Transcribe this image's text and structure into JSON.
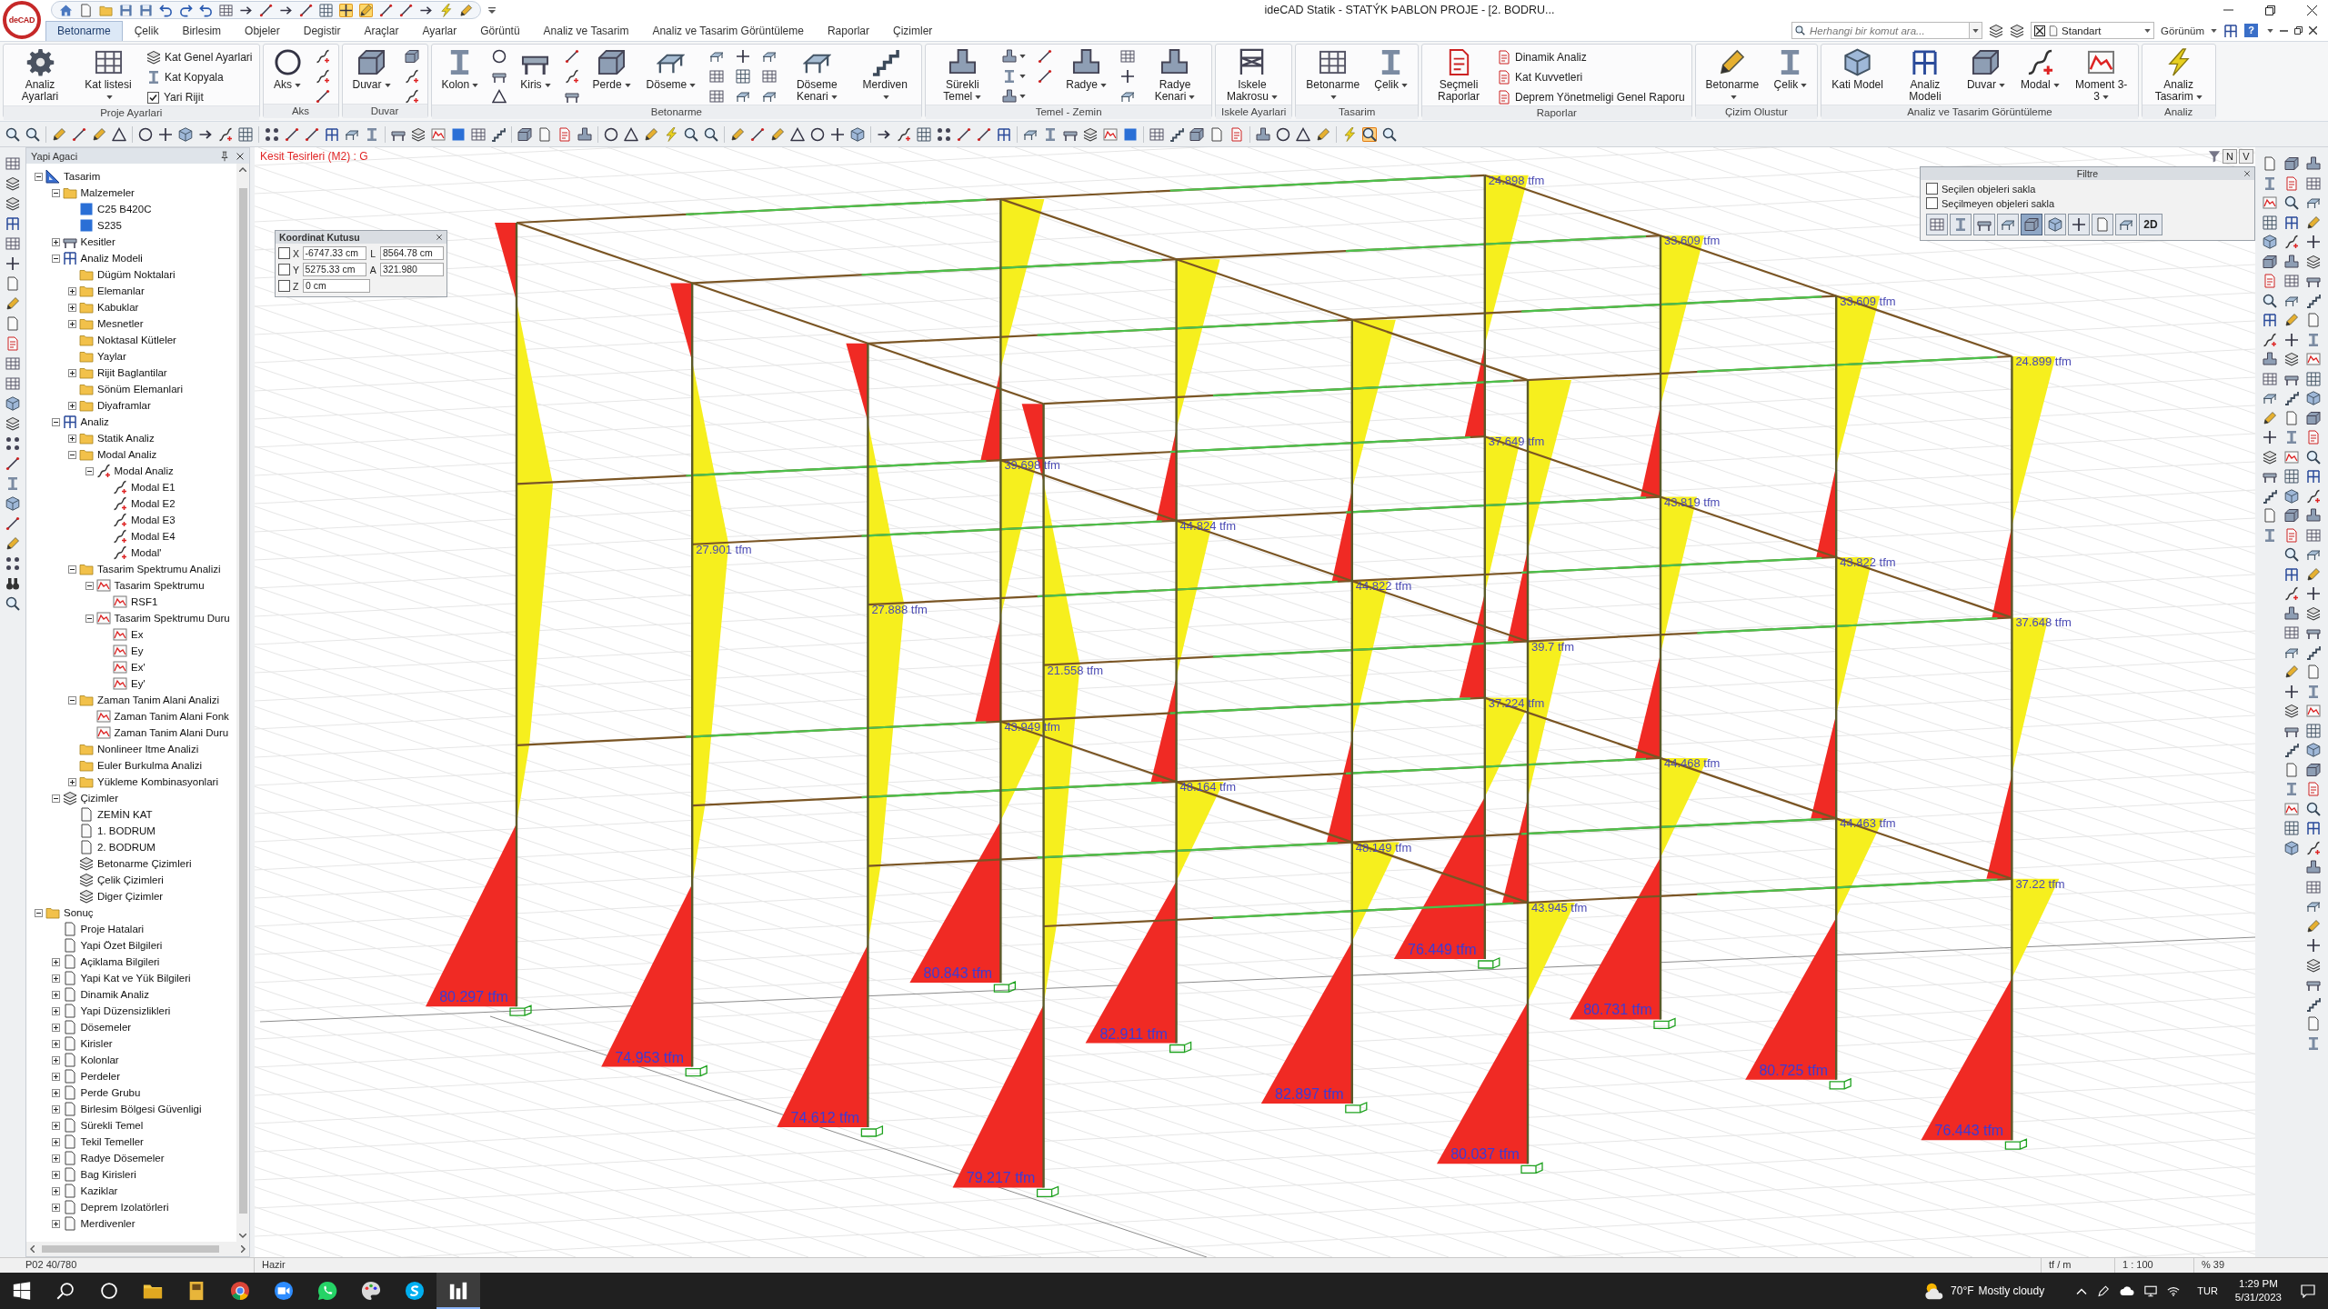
{
  "title_bar": {
    "logo": "deCAD",
    "quick_access": [
      {
        "on": false
      },
      {
        "on": false
      },
      {
        "on": false
      },
      {
        "on": false
      },
      {
        "on": false
      },
      {
        "on": false
      },
      {
        "on": false
      },
      {
        "on": false
      },
      {
        "on": false
      },
      {
        "on": false
      },
      {
        "on": false
      },
      {
        "on": false
      },
      {
        "on": false
      },
      {
        "on": false
      },
      {
        "on": true
      },
      {
        "on": true
      },
      {
        "on": false
      },
      {
        "on": false
      },
      {
        "on": false
      },
      {
        "on": false
      },
      {
        "on": false
      }
    ],
    "title": "ideCAD Statik - STATÝK ÞABLON PROJE - [2. BODRU..."
  },
  "ribbon": {
    "tabs": [
      {
        "label": "Betonarme",
        "selected": true
      },
      {
        "label": "Çelik",
        "selected": false
      },
      {
        "label": "Birlesim",
        "selected": false
      },
      {
        "label": "Objeler",
        "selected": false
      },
      {
        "label": "Degistir",
        "selected": false
      },
      {
        "label": "Araçlar",
        "selected": false
      },
      {
        "label": "Ayarlar",
        "selected": false
      },
      {
        "label": "Görüntü",
        "selected": false
      },
      {
        "label": "Analiz ve Tasarim",
        "selected": false
      },
      {
        "label": "Analiz ve Tasarim Görüntüleme",
        "selected": false
      },
      {
        "label": "Raporlar",
        "selected": false
      },
      {
        "label": "Çizimler",
        "selected": false
      }
    ],
    "search": {
      "placeholder": "Herhangi bir komut ara..."
    },
    "style_select": {
      "value": "Standart"
    },
    "view_menu": {
      "label": "Görünüm"
    },
    "help": "?",
    "groups": [
      {
        "label": "Proje Ayarlari",
        "items": [
          {
            "kind": "large",
            "label": "Analiz Ayarlari",
            "dropdown": false
          },
          {
            "kind": "large",
            "label": "Kat listesi",
            "dropdown": true
          },
          {
            "kind": "stack",
            "items": [
              {
                "kind": "small",
                "label": "Kat Genel Ayarlari"
              },
              {
                "kind": "small",
                "label": "Kat Kopyala"
              },
              {
                "kind": "check",
                "label": "Yari Rijit",
                "checked": true
              }
            ]
          }
        ]
      },
      {
        "label": "Aks",
        "items": [
          {
            "kind": "large",
            "label": "Aks",
            "dropdown": true
          },
          {
            "kind": "icon_column"
          }
        ]
      },
      {
        "label": "Duvar",
        "items": [
          {
            "kind": "large",
            "label": "Duvar",
            "dropdown": true
          },
          {
            "kind": "icon_column"
          }
        ]
      },
      {
        "label": "Betonarme",
        "items": [
          {
            "kind": "large",
            "label": "Kolon",
            "dropdown": true
          },
          {
            "kind": "icon_column"
          },
          {
            "kind": "large",
            "label": "Kiris",
            "dropdown": true
          },
          {
            "kind": "icon_column"
          },
          {
            "kind": "large",
            "label": "Perde",
            "dropdown": true
          },
          {
            "kind": "large",
            "label": "Döseme",
            "dropdown": true
          },
          {
            "kind": "icon_column"
          },
          {
            "kind": "icon_column"
          },
          {
            "kind": "icon_column"
          },
          {
            "kind": "large",
            "label": "Döseme Kenari",
            "dropdown": true
          },
          {
            "kind": "large",
            "label": "Merdiven",
            "dropdown": true
          }
        ]
      },
      {
        "label": "Temel - Zemin",
        "items": [
          {
            "kind": "large",
            "label": "Sürekli Temel",
            "dropdown": true
          },
          {
            "kind": "icon_column"
          },
          {
            "kind": "icon_column"
          },
          {
            "kind": "large",
            "label": "Radye",
            "dropdown": true
          },
          {
            "kind": "icon_column"
          },
          {
            "kind": "large",
            "label": "Radye Kenari",
            "dropdown": true
          }
        ]
      },
      {
        "label": "Iskele Ayarlari",
        "items": [
          {
            "kind": "large",
            "label": "Iskele Makrosu",
            "dropdown": true
          }
        ]
      },
      {
        "label": "Tasarim",
        "items": [
          {
            "kind": "large",
            "label": "Betonarme",
            "dropdown": true
          },
          {
            "kind": "large",
            "label": "Çelik",
            "dropdown": true
          }
        ]
      },
      {
        "label": "Raporlar",
        "items": [
          {
            "kind": "large",
            "label": "Seçmeli Raporlar",
            "dropdown": false
          },
          {
            "kind": "stack",
            "items": [
              {
                "kind": "small",
                "label": "Dinamik Analiz"
              },
              {
                "kind": "small",
                "label": "Kat Kuvvetleri"
              },
              {
                "kind": "small",
                "label": "Deprem Yönetmeligi Genel Raporu"
              }
            ]
          }
        ]
      },
      {
        "label": "Çizim Olustur",
        "items": [
          {
            "kind": "large",
            "label": "Betonarme",
            "dropdown": true
          },
          {
            "kind": "large",
            "label": "Çelik",
            "dropdown": true
          }
        ]
      },
      {
        "label": "Analiz ve Tasarim Görüntüleme",
        "items": [
          {
            "kind": "large",
            "label": "Kati Model",
            "dropdown": false
          },
          {
            "kind": "large",
            "label": "Analiz Modeli",
            "dropdown": false
          },
          {
            "kind": "large",
            "label": "Duvar",
            "dropdown": true
          },
          {
            "kind": "large",
            "label": "Modal",
            "dropdown": true
          },
          {
            "kind": "large",
            "label": "Moment 3-3",
            "dropdown": true
          }
        ]
      },
      {
        "label": "Analiz",
        "items": [
          {
            "kind": "large",
            "label": "Analiz Tasarim",
            "dropdown": true
          }
        ]
      }
    ]
  },
  "toolbar": [
    {
      "on": false
    },
    {
      "on": false
    },
    {
      "on": false
    },
    {
      "on": false
    },
    {
      "on": false
    },
    {
      "on": false
    },
    {
      "on": false
    },
    {
      "on": false
    },
    {
      "on": false
    },
    {
      "on": false
    },
    {
      "on": false
    },
    {
      "on": false
    },
    {
      "on": false
    },
    {
      "on": false
    },
    {
      "on": false
    },
    {
      "on": false
    },
    {
      "on": false
    },
    {
      "on": false
    },
    {
      "on": false
    },
    {
      "on": false
    },
    {
      "on": false
    },
    {
      "on": false
    },
    {
      "on": false
    },
    {
      "on": false
    },
    {
      "on": false
    },
    {
      "on": false
    },
    {
      "on": false
    },
    {
      "on": false
    },
    {
      "on": false
    },
    {
      "on": false
    },
    {
      "on": false
    },
    {
      "on": false
    },
    {
      "on": false
    },
    {
      "on": false
    },
    {
      "on": false
    },
    {
      "on": false
    },
    {
      "on": false
    },
    {
      "on": false
    },
    {
      "on": false
    },
    {
      "on": false
    },
    {
      "on": false
    },
    {
      "on": false
    },
    {
      "on": false
    },
    {
      "on": false
    },
    {
      "on": false
    },
    {
      "on": false
    },
    {
      "on": false
    },
    {
      "on": false
    },
    {
      "on": false
    },
    {
      "on": false
    },
    {
      "on": false
    },
    {
      "on": false
    },
    {
      "on": false
    },
    {
      "on": false
    },
    {
      "on": false
    },
    {
      "on": false
    },
    {
      "on": false
    },
    {
      "on": false
    },
    {
      "on": false
    },
    {
      "on": false
    },
    {
      "on": false
    },
    {
      "on": false
    },
    {
      "on": false
    },
    {
      "on": false
    },
    {
      "on": true
    },
    {
      "on": false
    }
  ],
  "tree_panel": {
    "title": "Yapi Agaci",
    "items": [
      {
        "label": "Tasarim",
        "kind": "set_square",
        "expanded": true,
        "children": [
          {
            "label": "Malzemeler",
            "kind": "folder",
            "expanded": true,
            "children": [
              {
                "label": "C25 B420C",
                "kind": "material"
              },
              {
                "label": "S235",
                "kind": "material"
              }
            ]
          },
          {
            "label": "Kesitler",
            "kind": "section",
            "expanded": false
          },
          {
            "label": "Analiz Modeli",
            "kind": "frame",
            "expanded": true,
            "children": [
              {
                "label": "Dügüm Noktalari",
                "kind": "folder"
              },
              {
                "label": "Elemanlar",
                "kind": "folder",
                "expanded": false
              },
              {
                "label": "Kabuklar",
                "kind": "folder",
                "expanded": false
              },
              {
                "label": "Mesnetler",
                "kind": "folder",
                "expanded": false
              },
              {
                "label": "Noktasal Kütleler",
                "kind": "folder"
              },
              {
                "label": "Yaylar",
                "kind": "folder"
              },
              {
                "label": "Rijit Baglantilar",
                "kind": "folder",
                "expanded": false
              },
              {
                "label": "Sönüm Elemanlari",
                "kind": "folder"
              },
              {
                "label": "Diyaframlar",
                "kind": "folder",
                "expanded": false
              }
            ]
          },
          {
            "label": "Analiz",
            "kind": "frame",
            "expanded": true,
            "children": [
              {
                "label": "Statik Analiz",
                "kind": "folder",
                "expanded": false
              },
              {
                "label": "Modal Analiz",
                "kind": "folder",
                "expanded": true,
                "children": [
                  {
                    "label": "Modal Analiz",
                    "kind": "curve",
                    "expanded": true,
                    "children": [
                      {
                        "label": "Modal E1",
                        "kind": "curve"
                      },
                      {
                        "label": "Modal E2",
                        "kind": "curve"
                      },
                      {
                        "label": "Modal E3",
                        "kind": "curve"
                      },
                      {
                        "label": "Modal E4",
                        "kind": "curve"
                      },
                      {
                        "label": "Modal'",
                        "kind": "curve"
                      }
                    ]
                  }
                ]
              },
              {
                "label": "Tasarim Spektrumu Analizi",
                "kind": "folder",
                "expanded": true,
                "children": [
                  {
                    "label": "Tasarim Spektrumu",
                    "kind": "graph",
                    "expanded": true,
                    "children": [
                      {
                        "label": "RSF1",
                        "kind": "graph"
                      }
                    ]
                  },
                  {
                    "label": "Tasarim Spektrumu Duru",
                    "kind": "graph",
                    "expanded": true,
                    "children": [
                      {
                        "label": "Ex",
                        "kind": "graph"
                      },
                      {
                        "label": "Ey",
                        "kind": "graph"
                      },
                      {
                        "label": "Ex'",
                        "kind": "graph"
                      },
                      {
                        "label": "Ey'",
                        "kind": "graph"
                      }
                    ]
                  }
                ]
              },
              {
                "label": "Zaman Tanim Alani Analizi",
                "kind": "folder",
                "expanded": true,
                "children": [
                  {
                    "label": "Zaman Tanim Alani Fonk",
                    "kind": "graph"
                  },
                  {
                    "label": "Zaman Tanim Alani Duru",
                    "kind": "graph"
                  }
                ]
              },
              {
                "label": "Nonlineer Itme Analizi",
                "kind": "folder"
              },
              {
                "label": "Euler Burkulma Analizi",
                "kind": "folder"
              },
              {
                "label": "Yükleme Kombinasyonlari",
                "kind": "folder",
                "expanded": false
              }
            ]
          },
          {
            "label": "Çizimler",
            "kind": "layers",
            "expanded": true,
            "children": [
              {
                "label": "ZEMİN KAT",
                "kind": "page"
              },
              {
                "label": "1. BODRUM",
                "kind": "page"
              },
              {
                "label": "2. BODRUM",
                "kind": "page"
              },
              {
                "label": "Betonarme Çizimleri",
                "kind": "layers"
              },
              {
                "label": "Çelik Çizimleri",
                "kind": "layers"
              },
              {
                "label": "Diger Çizimler",
                "kind": "layers"
              }
            ]
          }
        ]
      },
      {
        "label": "Sonuç",
        "kind": "folder",
        "expanded": true,
        "children": [
          {
            "label": "Proje Hatalari",
            "kind": "page"
          },
          {
            "label": "Yapi Özet Bilgileri",
            "kind": "page"
          },
          {
            "label": "Açiklama Bilgileri",
            "kind": "page",
            "expanded": false
          },
          {
            "label": "Yapi Kat ve Yük Bilgileri",
            "kind": "page",
            "expanded": false
          },
          {
            "label": "Dinamik Analiz",
            "kind": "page",
            "expanded": false
          },
          {
            "label": "Yapi Düzensizlikleri",
            "kind": "page",
            "expanded": false
          },
          {
            "label": "Dösemeler",
            "kind": "page",
            "expanded": false
          },
          {
            "label": "Kirisler",
            "kind": "page",
            "expanded": false
          },
          {
            "label": "Kolonlar",
            "kind": "page",
            "expanded": false
          },
          {
            "label": "Perdeler",
            "kind": "page",
            "expanded": false
          },
          {
            "label": "Perde Grubu",
            "kind": "page",
            "expanded": false
          },
          {
            "label": "Birlesim Bölgesi Güvenligi",
            "kind": "page",
            "expanded": false
          },
          {
            "label": "Sürekli Temel",
            "kind": "page",
            "expanded": false
          },
          {
            "label": "Tekil Temeller",
            "kind": "page",
            "expanded": false
          },
          {
            "label": "Radye Dösemeler",
            "kind": "page",
            "expanded": false
          },
          {
            "label": "Bag Kirisleri",
            "kind": "page",
            "expanded": false
          },
          {
            "label": "Kaziklar",
            "kind": "page",
            "expanded": false
          },
          {
            "label": "Deprem Izolatörleri",
            "kind": "page",
            "expanded": false
          },
          {
            "label": "Merdivenler",
            "kind": "page",
            "expanded": false
          }
        ]
      }
    ]
  },
  "canvas": {
    "view_title": "Kesit Tesirleri (M2) : G",
    "view_buttons": [
      "N",
      "V"
    ],
    "coordinate_box": {
      "title": "Koordinat Kutusu",
      "rows": [
        {
          "axis": "X",
          "checked": false,
          "value": "-6747.33 cm",
          "extra_label": "L",
          "extra_value": "8564.78 cm"
        },
        {
          "axis": "Y",
          "checked": false,
          "value": "5275.33 cm",
          "extra_label": "A",
          "extra_value": "321.980"
        },
        {
          "axis": "Z",
          "checked": false,
          "value": "0 cm"
        }
      ]
    },
    "filter_panel": {
      "title": "Filtre",
      "options": [
        {
          "label": "Seçilen objeleri sakla",
          "checked": false
        },
        {
          "label": "Seçilmeyen objeleri sakla",
          "checked": false
        }
      ],
      "buttons": [
        {
          "selected": false
        },
        {
          "selected": false
        },
        {
          "selected": false
        },
        {
          "selected": false
        },
        {
          "selected": true
        },
        {
          "selected": false
        },
        {
          "selected": false
        },
        {
          "selected": false
        },
        {
          "selected": false
        }
      ],
      "mode_button": "2D"
    },
    "joint_labels": [
      "24.898 tfm",
      "33.609 tfm",
      "33.609 tfm",
      "24.899 tfm",
      "37.649 tfm",
      "39.698 tfm",
      "43.819 tfm",
      "44.824 tfm",
      "27.901 tfm",
      "43.822 tfm",
      "44.822 tfm",
      "27.888 tfm",
      "37.648 tfm",
      "39.7 tfm",
      "21.558 tfm",
      "37.224 tfm",
      "43.949 tfm",
      "44.468 tfm",
      "48.164 tfm",
      "44.463 tfm",
      "48.149 tfm",
      "37.22 tfm",
      "43.945 tfm"
    ],
    "moment_labels": [
      "76.449 tfm",
      "80.843 tfm",
      "80.297 tfm",
      "80.731 tfm",
      "82.911 tfm",
      "74.953 tfm",
      "80.725 tfm",
      "82.897 tfm",
      "74.612 tfm",
      "76.443 tfm",
      "80.037 tfm",
      "79.217 tfm"
    ]
  },
  "status_bar": {
    "position": "P02 40/780",
    "message": "Hazir",
    "unit": "tf / m",
    "scale": "1 : 100",
    "zoom": "% 39"
  },
  "taskbar": {
    "apps": [
      {
        "selected": false
      },
      {
        "selected": false
      },
      {
        "selected": false
      },
      {
        "selected": false
      },
      {
        "selected": false
      },
      {
        "selected": false
      },
      {
        "selected": false
      },
      {
        "selected": true
      }
    ],
    "weather": {
      "temperature": "70°F",
      "condition": "Mostly cloudy"
    },
    "language": "TUR",
    "time": "1:29 PM",
    "date": "5/31/2023"
  }
}
